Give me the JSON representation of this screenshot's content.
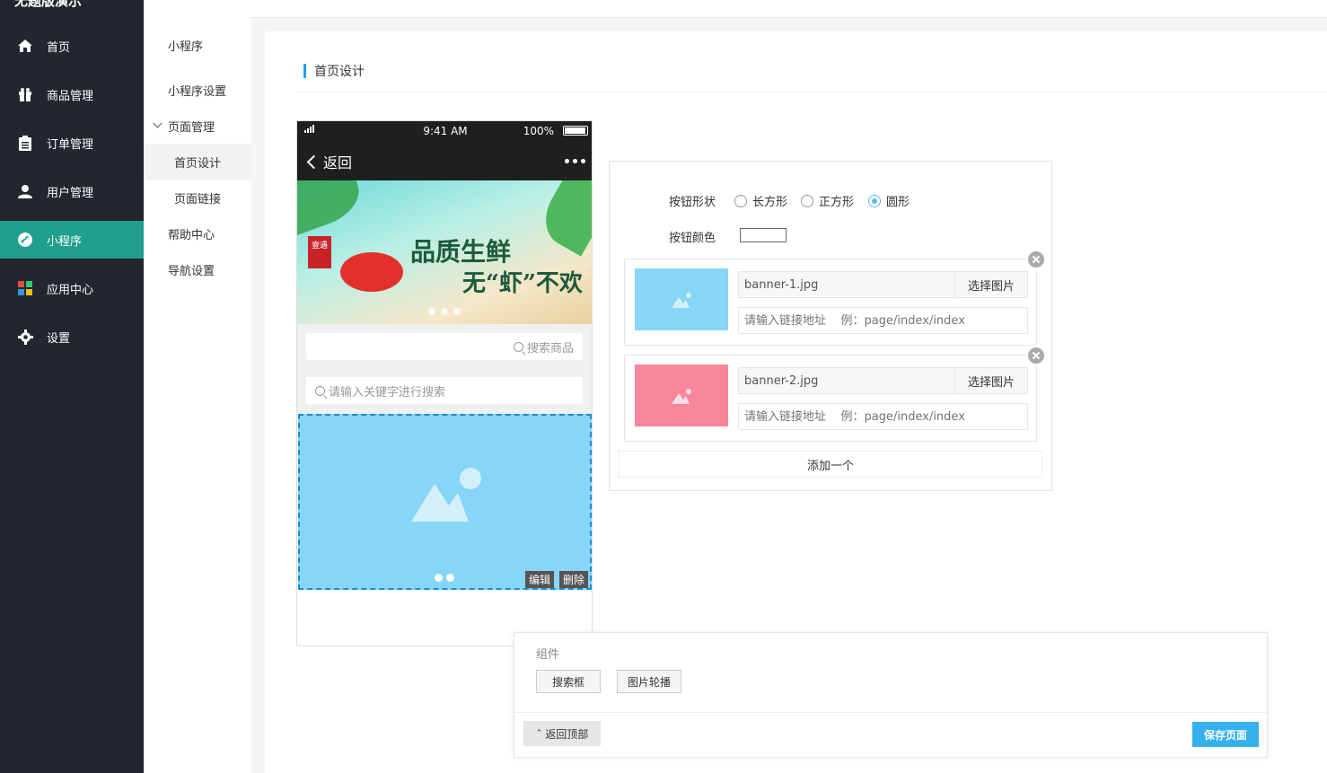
{
  "app": {
    "brand": "无题版演示"
  },
  "sidebar": {
    "items": [
      {
        "label": "首页",
        "icon": "home-icon"
      },
      {
        "label": "商品管理",
        "icon": "gift-icon"
      },
      {
        "label": "订单管理",
        "icon": "clipboard-icon"
      },
      {
        "label": "用户管理",
        "icon": "user-icon"
      },
      {
        "label": "小程序",
        "icon": "miniprogram-icon",
        "active": true
      },
      {
        "label": "应用中心",
        "icon": "apps-icon"
      },
      {
        "label": "设置",
        "icon": "gear-icon"
      }
    ]
  },
  "submenu": {
    "items": [
      {
        "label": "小程序"
      },
      {
        "label": "小程序设置"
      },
      {
        "label": "页面管理",
        "expanded": true
      },
      {
        "label": "首页设计",
        "active": true
      },
      {
        "label": "页面链接"
      },
      {
        "label": "帮助中心"
      },
      {
        "label": "导航设置"
      }
    ]
  },
  "page": {
    "title": "首页设计"
  },
  "phone": {
    "time": "9:41 AM",
    "battery": "100%",
    "back_label": "返回",
    "banner": {
      "seal": "壹遇",
      "line1": "品质生鲜",
      "line2": "无“虾”不欢"
    },
    "search_placeholder": "搜索商品",
    "keyword_placeholder": "请输入关键字进行搜索",
    "edit_label": "编辑",
    "delete_label": "删除"
  },
  "settings": {
    "shape_label": "按钮形状",
    "shapes": [
      {
        "label": "长方形",
        "selected": false
      },
      {
        "label": "正方形",
        "selected": false
      },
      {
        "label": "圆形",
        "selected": true
      }
    ],
    "color_label": "按钮颜色",
    "button_color": "#ffffff",
    "items": [
      {
        "file": "banner-1.jpg",
        "pick_label": "选择图片",
        "link_placeholder": "请输入链接地址    例：page/index/index",
        "thumb_color": "#87d5f7"
      },
      {
        "file": "banner-2.jpg",
        "pick_label": "选择图片",
        "link_placeholder": "请输入链接地址    例：page/index/index",
        "thumb_color": "#f7869a"
      }
    ],
    "add_label": "添加一个"
  },
  "drawer": {
    "label": "组件",
    "components": [
      "搜索框",
      "图片轮播"
    ],
    "back_top_label": "返回顶部",
    "save_label": "保存页面"
  },
  "colors": {
    "accent": "#1e9e8c",
    "primary": "#36b1ee",
    "sidebar_bg": "#23262e"
  }
}
